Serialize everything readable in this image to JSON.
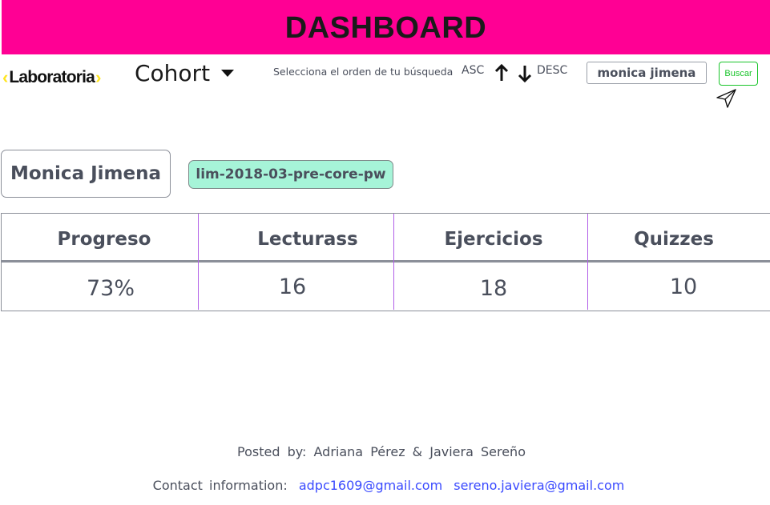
{
  "header": {
    "title": "DASHBOARD"
  },
  "nav": {
    "logo_text": "Laboratoria",
    "cohort_label": "Cohort",
    "order_label": "Selecciona el orden de tu búsqueda",
    "asc_label": "ASC",
    "desc_label": "DESC",
    "search_value": "monica jimena",
    "search_button_label": "Buscar",
    "icons": [
      "chevron-down-icon",
      "arrow-up-icon",
      "arrow-down-icon",
      "send-icon"
    ]
  },
  "student": {
    "name": "Monica Jimena",
    "cohort": "lim-2018-03-pre-core-pw"
  },
  "stats": {
    "headers": [
      "Progreso",
      "Lecturass",
      "Ejercicios",
      "Quizzes"
    ],
    "values": [
      "73%",
      "16",
      "18",
      "10"
    ]
  },
  "footer": {
    "posted_by": "Posted by: Adriana Pérez & Javiera Sereño",
    "contact_label": "Contact information:",
    "email_1": "adpc1609@gmail.com",
    "email_2": "sereno.javiera@gmail.com"
  },
  "colors": {
    "header_bg": "#ff0094",
    "badge_bg": "#a6f4d8",
    "button_accent": "#19c42a",
    "column_divider": "#b25fe8",
    "link": "#3b4bff"
  }
}
